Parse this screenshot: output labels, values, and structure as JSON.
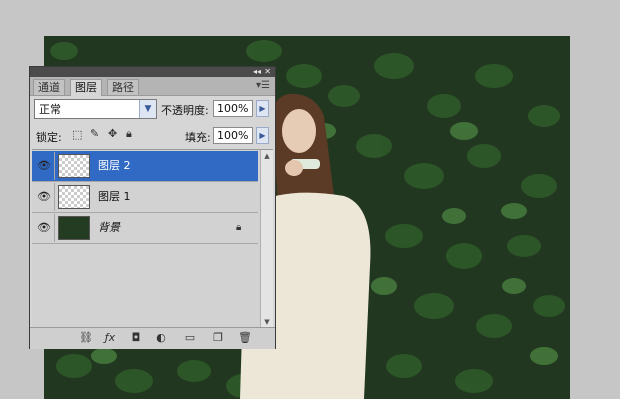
{
  "panel": {
    "tabs": [
      {
        "label": "通道",
        "active": false
      },
      {
        "label": "图层",
        "active": true
      },
      {
        "label": "路径",
        "active": false
      }
    ],
    "collapse_icon": "double-chevron-icon",
    "close_icon": "close-icon",
    "menu_icon": "panel-menu-icon"
  },
  "blend": {
    "mode": "正常",
    "opacity_label": "不透明度:",
    "opacity_value": "100%"
  },
  "lock": {
    "label": "锁定:",
    "icons": [
      "lock-transparency-icon",
      "lock-pixels-icon",
      "lock-position-icon",
      "lock-all-icon"
    ],
    "fill_label": "填充:",
    "fill_value": "100%"
  },
  "layers": [
    {
      "name": "图层 2",
      "selected": true,
      "visible": true,
      "thumb": "transparent"
    },
    {
      "name": "图层 1",
      "selected": false,
      "visible": true,
      "thumb": "transparent"
    },
    {
      "name": "背景",
      "selected": false,
      "visible": true,
      "thumb": "photo",
      "locked": true
    }
  ],
  "footer_icons": [
    "link-layers-icon",
    "fx-icon",
    "add-mask-icon",
    "adjustment-layer-icon",
    "new-group-icon",
    "new-layer-icon",
    "delete-icon"
  ],
  "colors": {
    "selection": "#316ac5",
    "panel_bg": "#d6d6d6",
    "canvas_bg": "#c6c6c6",
    "foliage": "#21371f"
  }
}
